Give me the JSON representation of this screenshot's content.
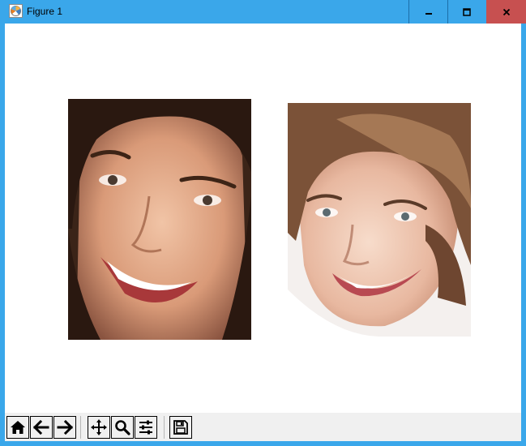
{
  "window": {
    "title": "Figure 1",
    "accent_color": "#3aa7ea",
    "close_color": "#c75050",
    "controls": [
      "minimize-icon",
      "maximize-icon",
      "close-icon"
    ]
  },
  "figure": {
    "images": [
      {
        "name": "face-image-left",
        "description_icon": "photo"
      },
      {
        "name": "face-image-right",
        "description_icon": "photo"
      }
    ]
  },
  "toolbar": {
    "buttons": [
      "home-icon",
      "back-arrow-icon",
      "forward-arrow-icon",
      "pan-icon",
      "zoom-icon",
      "configure-subplots-icon",
      "save-icon"
    ]
  }
}
